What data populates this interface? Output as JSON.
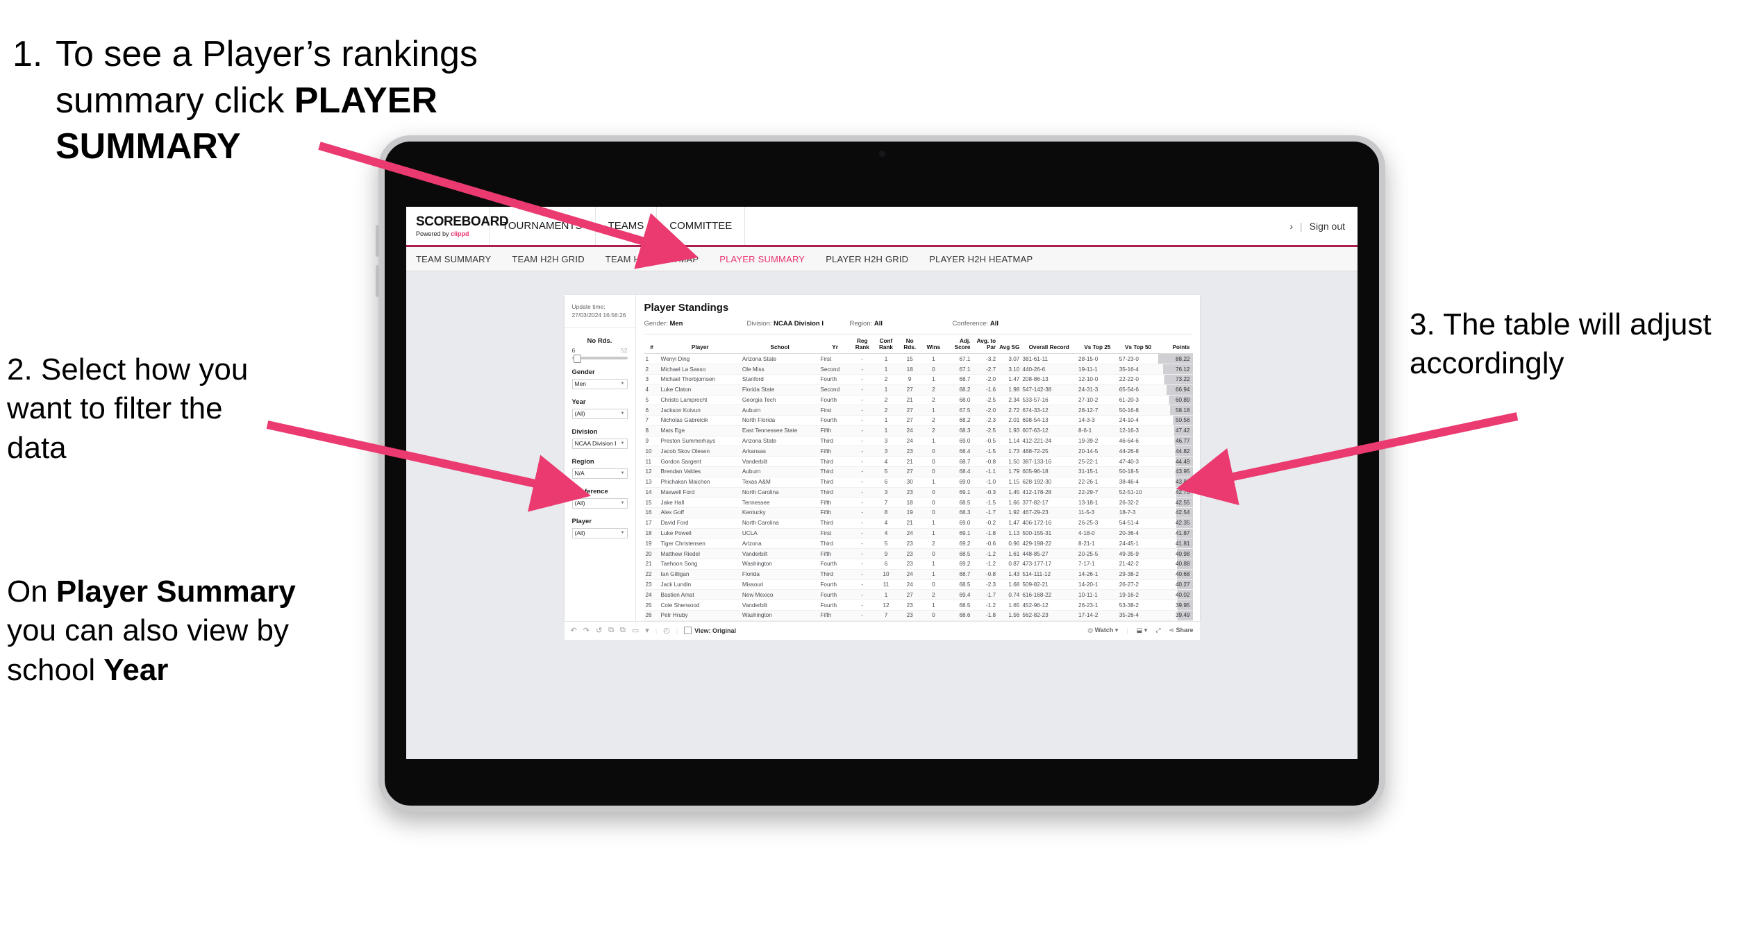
{
  "annotations": {
    "step1_num": "1.",
    "step1_text_a": "To see a Player’s rankings summary click ",
    "step1_text_b": "PLAYER SUMMARY",
    "step2_a": "2. Select how you want to filter the data",
    "step2_b_pre": "On ",
    "step2_b_bold": "Player Summary",
    "step2_b_mid": " you can also view by school ",
    "step2_b_bold2": "Year",
    "step3": "3. The table will adjust accordingly"
  },
  "colors": {
    "accent_pink": "#e8336d",
    "arrow_pink": "#eb3a70",
    "nav_underline": "#aa1f4b",
    "app_bg": "#e8eaed"
  },
  "app": {
    "brand": {
      "logo": "SCOREBOARD",
      "powered_pre": "Powered by ",
      "powered_brand": "clippd"
    },
    "top_nav": [
      "TOURNAMENTS",
      "TEAMS",
      "COMMITTEE"
    ],
    "top_right": {
      "chevron": "›",
      "divider": "|",
      "sign_out": "Sign out"
    },
    "sub_nav": [
      {
        "label": "TEAM SUMMARY",
        "active": false
      },
      {
        "label": "TEAM H2H GRID",
        "active": false
      },
      {
        "label": "TEAM H2H HEATMAP",
        "active": false
      },
      {
        "label": "PLAYER SUMMARY",
        "active": true
      },
      {
        "label": "PLAYER H2H GRID",
        "active": false
      },
      {
        "label": "PLAYER H2H HEATMAP",
        "active": false
      }
    ]
  },
  "rail": {
    "update_label": "Update time:",
    "update_value": "27/03/2024 16:56:26",
    "slider": {
      "label": "No Rds.",
      "min": "6",
      "max": "52",
      "value": 6
    },
    "filters": [
      {
        "label": "Gender",
        "value": "Men"
      },
      {
        "label": "Year",
        "value": "(All)"
      },
      {
        "label": "Division",
        "value": "NCAA Division I"
      },
      {
        "label": "Region",
        "value": "N/A"
      },
      {
        "label": "Conference",
        "value": "(All)"
      },
      {
        "label": "Player",
        "value": "(All)"
      }
    ]
  },
  "panel": {
    "title": "Player Standings",
    "meta": [
      {
        "label": "Gender:",
        "value": "Men"
      },
      {
        "label": "Division:",
        "value": "NCAA Division I"
      },
      {
        "label": "Region:",
        "value": "All"
      },
      {
        "label": "Conference:",
        "value": "All"
      }
    ]
  },
  "table": {
    "columns": [
      "#",
      "Player",
      "School",
      "Yr",
      "Reg Rank",
      "Conf Rank",
      "No Rds.",
      "Wins",
      "Adj. Score",
      "Avg. to Par",
      "Avg SG",
      "Overall Record",
      "Vs Top 25",
      "Vs Top 50",
      "Points"
    ],
    "rows": [
      [
        "1",
        "Wenyi Ding",
        "Arizona State",
        "First",
        "-",
        "1",
        "15",
        "1",
        "67.1",
        "-3.2",
        "3.07",
        "381-61-11",
        "28-15-0",
        "57-23-0",
        "88.22"
      ],
      [
        "2",
        "Michael La Sasso",
        "Ole Miss",
        "Second",
        "-",
        "1",
        "18",
        "0",
        "67.1",
        "-2.7",
        "3.10",
        "440-26-6",
        "19-11-1",
        "35-16-4",
        "76.12"
      ],
      [
        "3",
        "Michael Thorbjornsen",
        "Stanford",
        "Fourth",
        "-",
        "2",
        "9",
        "1",
        "68.7",
        "-2.0",
        "1.47",
        "208-86-13",
        "12-10-0",
        "22-22-0",
        "73.22"
      ],
      [
        "4",
        "Luke Claton",
        "Florida State",
        "Second",
        "-",
        "1",
        "27",
        "2",
        "68.2",
        "-1.6",
        "1.98",
        "547-142-38",
        "24-31-3",
        "65-54-6",
        "66.94"
      ],
      [
        "5",
        "Christo Lamprecht",
        "Georgia Tech",
        "Fourth",
        "-",
        "2",
        "21",
        "2",
        "68.0",
        "-2.5",
        "2.34",
        "533-57-16",
        "27-10-2",
        "61-20-3",
        "60.89"
      ],
      [
        "6",
        "Jackson Koivun",
        "Auburn",
        "First",
        "-",
        "2",
        "27",
        "1",
        "67.5",
        "-2.0",
        "2.72",
        "674-33-12",
        "28-12-7",
        "50-16-8",
        "58.18"
      ],
      [
        "7",
        "Nicholas Gabrelcik",
        "North Florida",
        "Fourth",
        "-",
        "1",
        "27",
        "2",
        "68.2",
        "-2.3",
        "2.01",
        "698-54-13",
        "14-3-3",
        "24-10-4",
        "50.56"
      ],
      [
        "8",
        "Mats Ege",
        "East Tennessee State",
        "Fifth",
        "-",
        "1",
        "24",
        "2",
        "68.3",
        "-2.5",
        "1.93",
        "607-63-12",
        "8-6-1",
        "12-16-3",
        "47.42"
      ],
      [
        "9",
        "Preston Summerhays",
        "Arizona State",
        "Third",
        "-",
        "3",
        "24",
        "1",
        "69.0",
        "-0.5",
        "1.14",
        "412-221-24",
        "19-39-2",
        "46-64-6",
        "46.77"
      ],
      [
        "10",
        "Jacob Skov Olesen",
        "Arkansas",
        "Fifth",
        "-",
        "3",
        "23",
        "0",
        "68.4",
        "-1.5",
        "1.73",
        "488-72-25",
        "20-14-5",
        "44-26-8",
        "44.82"
      ],
      [
        "11",
        "Gordon Sargent",
        "Vanderbilt",
        "Third",
        "-",
        "4",
        "21",
        "0",
        "68.7",
        "-0.8",
        "1.50",
        "387-133-16",
        "25-22-1",
        "47-40-3",
        "44.49"
      ],
      [
        "12",
        "Brendan Valdes",
        "Auburn",
        "Third",
        "-",
        "5",
        "27",
        "0",
        "68.4",
        "-1.1",
        "1.79",
        "605-96-18",
        "31-15-1",
        "50-18-5",
        "43.95"
      ],
      [
        "13",
        "Phichaksn Maichon",
        "Texas A&M",
        "Third",
        "-",
        "6",
        "30",
        "1",
        "69.0",
        "-1.0",
        "1.15",
        "628-192-30",
        "22-26-1",
        "38-46-4",
        "43.83"
      ],
      [
        "14",
        "Maxwell Ford",
        "North Carolina",
        "Third",
        "-",
        "3",
        "23",
        "0",
        "69.1",
        "-0.3",
        "1.45",
        "412-178-28",
        "22-29-7",
        "52-51-10",
        "42.75"
      ],
      [
        "15",
        "Jake Hall",
        "Tennessee",
        "Fifth",
        "-",
        "7",
        "18",
        "0",
        "68.5",
        "-1.5",
        "1.66",
        "377-82-17",
        "13-18-1",
        "26-32-2",
        "42.55"
      ],
      [
        "16",
        "Alex Goff",
        "Kentucky",
        "Fifth",
        "-",
        "8",
        "19",
        "0",
        "68.3",
        "-1.7",
        "1.92",
        "467-29-23",
        "11-5-3",
        "18-7-3",
        "42.54"
      ],
      [
        "17",
        "David Ford",
        "North Carolina",
        "Third",
        "-",
        "4",
        "21",
        "1",
        "69.0",
        "-0.2",
        "1.47",
        "406-172-16",
        "26-25-3",
        "54-51-4",
        "42.35"
      ],
      [
        "18",
        "Luke Powell",
        "UCLA",
        "First",
        "-",
        "4",
        "24",
        "1",
        "69.1",
        "-1.8",
        "1.13",
        "500-155-31",
        "4-18-0",
        "20-36-4",
        "41.87"
      ],
      [
        "19",
        "Tiger Christensen",
        "Arizona",
        "Third",
        "-",
        "5",
        "23",
        "2",
        "69.2",
        "-0.6",
        "0.96",
        "429-198-22",
        "8-21-1",
        "24-45-1",
        "41.81"
      ],
      [
        "20",
        "Matthew Riedel",
        "Vanderbilt",
        "Fifth",
        "-",
        "9",
        "23",
        "0",
        "68.5",
        "-1.2",
        "1.61",
        "448-85-27",
        "20-25-5",
        "49-35-9",
        "40.98"
      ],
      [
        "21",
        "Taehoon Song",
        "Washington",
        "Fourth",
        "-",
        "6",
        "23",
        "1",
        "69.2",
        "-1.2",
        "0.87",
        "473-177-17",
        "7-17-1",
        "21-42-2",
        "40.88"
      ],
      [
        "22",
        "Ian Gilligan",
        "Florida",
        "Third",
        "-",
        "10",
        "24",
        "1",
        "68.7",
        "-0.8",
        "1.43",
        "514-111-12",
        "14-26-1",
        "29-38-2",
        "40.68"
      ],
      [
        "23",
        "Jack Lundin",
        "Missouri",
        "Fourth",
        "-",
        "11",
        "24",
        "0",
        "68.5",
        "-2.3",
        "1.68",
        "509-82-21",
        "14-20-1",
        "26-27-2",
        "40.27"
      ],
      [
        "24",
        "Bastien Amat",
        "New Mexico",
        "Fourth",
        "-",
        "1",
        "27",
        "2",
        "69.4",
        "-1.7",
        "0.74",
        "616-168-22",
        "10-11-1",
        "19-16-2",
        "40.02"
      ],
      [
        "25",
        "Cole Sherwood",
        "Vanderbilt",
        "Fourth",
        "-",
        "12",
        "23",
        "1",
        "68.5",
        "-1.2",
        "1.65",
        "452-96-12",
        "26-23-1",
        "53-38-2",
        "39.95"
      ],
      [
        "26",
        "Petr Hruby",
        "Washington",
        "Fifth",
        "-",
        "7",
        "23",
        "0",
        "68.6",
        "-1.8",
        "1.56",
        "562-82-23",
        "17-14-2",
        "35-26-4",
        "39.49"
      ]
    ]
  },
  "toolbar": {
    "undo": "↶",
    "redo": "↷",
    "revert": "↺",
    "refresh": "⧉",
    "pause": "⧉",
    "alerts": "▭",
    "caret": "▾",
    "divider": "|",
    "clock": "◴",
    "view_label": "View: Original",
    "watch": "Watch",
    "watch_caret": "▾",
    "download_caret": "▾",
    "fullscreen": "⤢",
    "share": "Share"
  }
}
